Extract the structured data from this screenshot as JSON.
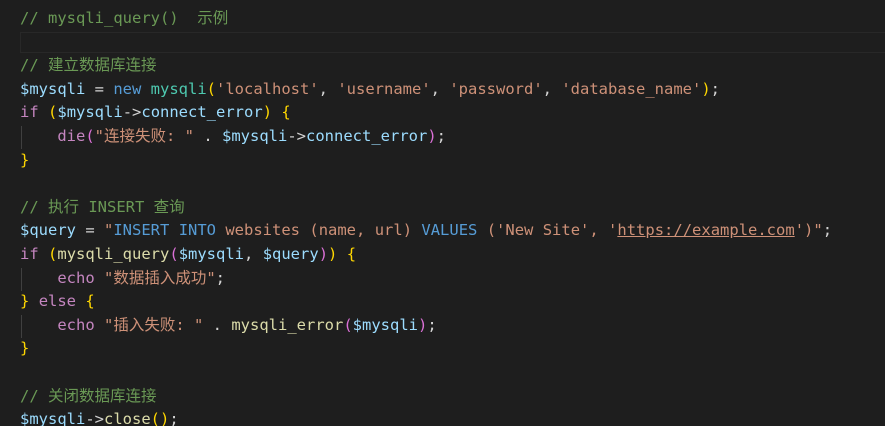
{
  "editor": {
    "lines": [
      [
        {
          "t": "// mysqli_query()  示例",
          "c": "c-comment"
        }
      ],
      [],
      [
        {
          "t": "// 建立数据库连接",
          "c": "c-comment"
        }
      ],
      [
        {
          "t": "$mysqli",
          "c": "c-var"
        },
        {
          "t": " = ",
          "c": "c-op"
        },
        {
          "t": "new",
          "c": "c-kw-blue"
        },
        {
          "t": " ",
          "c": "c-op"
        },
        {
          "t": "mysqli",
          "c": "c-class"
        },
        {
          "t": "(",
          "c": "c-br1"
        },
        {
          "t": "'localhost'",
          "c": "c-str"
        },
        {
          "t": ", ",
          "c": "c-punct"
        },
        {
          "t": "'username'",
          "c": "c-str"
        },
        {
          "t": ", ",
          "c": "c-punct"
        },
        {
          "t": "'password'",
          "c": "c-str"
        },
        {
          "t": ", ",
          "c": "c-punct"
        },
        {
          "t": "'database_name'",
          "c": "c-str"
        },
        {
          "t": ")",
          "c": "c-br1"
        },
        {
          "t": ";",
          "c": "c-punct"
        }
      ],
      [
        {
          "t": "if",
          "c": "c-kw-purple"
        },
        {
          "t": " ",
          "c": "c-op"
        },
        {
          "t": "(",
          "c": "c-br1"
        },
        {
          "t": "$mysqli",
          "c": "c-var"
        },
        {
          "t": "->",
          "c": "c-op"
        },
        {
          "t": "connect_error",
          "c": "c-var"
        },
        {
          "t": ")",
          "c": "c-br1"
        },
        {
          "t": " ",
          "c": "c-op"
        },
        {
          "t": "{",
          "c": "c-br1"
        }
      ],
      [
        {
          "t": "    ",
          "c": "c-op"
        },
        {
          "t": "die",
          "c": "c-kw-purple"
        },
        {
          "t": "(",
          "c": "c-br2"
        },
        {
          "t": "\"连接失败: \"",
          "c": "c-str"
        },
        {
          "t": " . ",
          "c": "c-op"
        },
        {
          "t": "$mysqli",
          "c": "c-var"
        },
        {
          "t": "->",
          "c": "c-op"
        },
        {
          "t": "connect_error",
          "c": "c-var"
        },
        {
          "t": ")",
          "c": "c-br2"
        },
        {
          "t": ";",
          "c": "c-punct"
        }
      ],
      [
        {
          "t": "}",
          "c": "c-br1"
        }
      ],
      [],
      [
        {
          "t": "// 执行 INSERT 查询",
          "c": "c-comment"
        }
      ],
      [
        {
          "t": "$query",
          "c": "c-var"
        },
        {
          "t": " = ",
          "c": "c-op"
        },
        {
          "t": "\"",
          "c": "c-str"
        },
        {
          "t": "INSERT",
          "c": "c-sql"
        },
        {
          "t": " ",
          "c": "c-str"
        },
        {
          "t": "INTO",
          "c": "c-sql"
        },
        {
          "t": " websites ",
          "c": "c-str"
        },
        {
          "t": "(",
          "c": "c-str"
        },
        {
          "t": "name",
          "c": "c-str"
        },
        {
          "t": ", ",
          "c": "c-str"
        },
        {
          "t": "url",
          "c": "c-str"
        },
        {
          "t": ")",
          "c": "c-str"
        },
        {
          "t": " ",
          "c": "c-str"
        },
        {
          "t": "VALUES",
          "c": "c-sql"
        },
        {
          "t": " (",
          "c": "c-str"
        },
        {
          "t": "'New Site'",
          "c": "c-str"
        },
        {
          "t": ", '",
          "c": "c-str"
        },
        {
          "t": "https://example.com",
          "c": "c-url"
        },
        {
          "t": "')\"",
          "c": "c-str"
        },
        {
          "t": ";",
          "c": "c-punct"
        }
      ],
      [
        {
          "t": "if",
          "c": "c-kw-purple"
        },
        {
          "t": " ",
          "c": "c-op"
        },
        {
          "t": "(",
          "c": "c-br1"
        },
        {
          "t": "mysqli_query",
          "c": "c-fn"
        },
        {
          "t": "(",
          "c": "c-br2"
        },
        {
          "t": "$mysqli",
          "c": "c-var"
        },
        {
          "t": ", ",
          "c": "c-punct"
        },
        {
          "t": "$query",
          "c": "c-var"
        },
        {
          "t": ")",
          "c": "c-br2"
        },
        {
          "t": ")",
          "c": "c-br1"
        },
        {
          "t": " ",
          "c": "c-op"
        },
        {
          "t": "{",
          "c": "c-br1"
        }
      ],
      [
        {
          "t": "    ",
          "c": "c-op"
        },
        {
          "t": "echo",
          "c": "c-kw-purple"
        },
        {
          "t": " ",
          "c": "c-op"
        },
        {
          "t": "\"数据插入成功\"",
          "c": "c-str"
        },
        {
          "t": ";",
          "c": "c-punct"
        }
      ],
      [
        {
          "t": "}",
          "c": "c-br1"
        },
        {
          "t": " ",
          "c": "c-op"
        },
        {
          "t": "else",
          "c": "c-kw-purple"
        },
        {
          "t": " ",
          "c": "c-op"
        },
        {
          "t": "{",
          "c": "c-br1"
        }
      ],
      [
        {
          "t": "    ",
          "c": "c-op"
        },
        {
          "t": "echo",
          "c": "c-kw-purple"
        },
        {
          "t": " ",
          "c": "c-op"
        },
        {
          "t": "\"插入失败: \"",
          "c": "c-str"
        },
        {
          "t": " . ",
          "c": "c-op"
        },
        {
          "t": "mysqli_error",
          "c": "c-fn"
        },
        {
          "t": "(",
          "c": "c-br2"
        },
        {
          "t": "$mysqli",
          "c": "c-var"
        },
        {
          "t": ")",
          "c": "c-br2"
        },
        {
          "t": ";",
          "c": "c-punct"
        }
      ],
      [
        {
          "t": "}",
          "c": "c-br1"
        }
      ],
      [],
      [
        {
          "t": "// 关闭数据库连接",
          "c": "c-comment"
        }
      ],
      [
        {
          "t": "$mysqli",
          "c": "c-var"
        },
        {
          "t": "->",
          "c": "c-op"
        },
        {
          "t": "close",
          "c": "c-fn"
        },
        {
          "t": "(",
          "c": "c-br1"
        },
        {
          "t": ")",
          "c": "c-br1"
        },
        {
          "t": ";",
          "c": "c-punct"
        }
      ]
    ]
  }
}
